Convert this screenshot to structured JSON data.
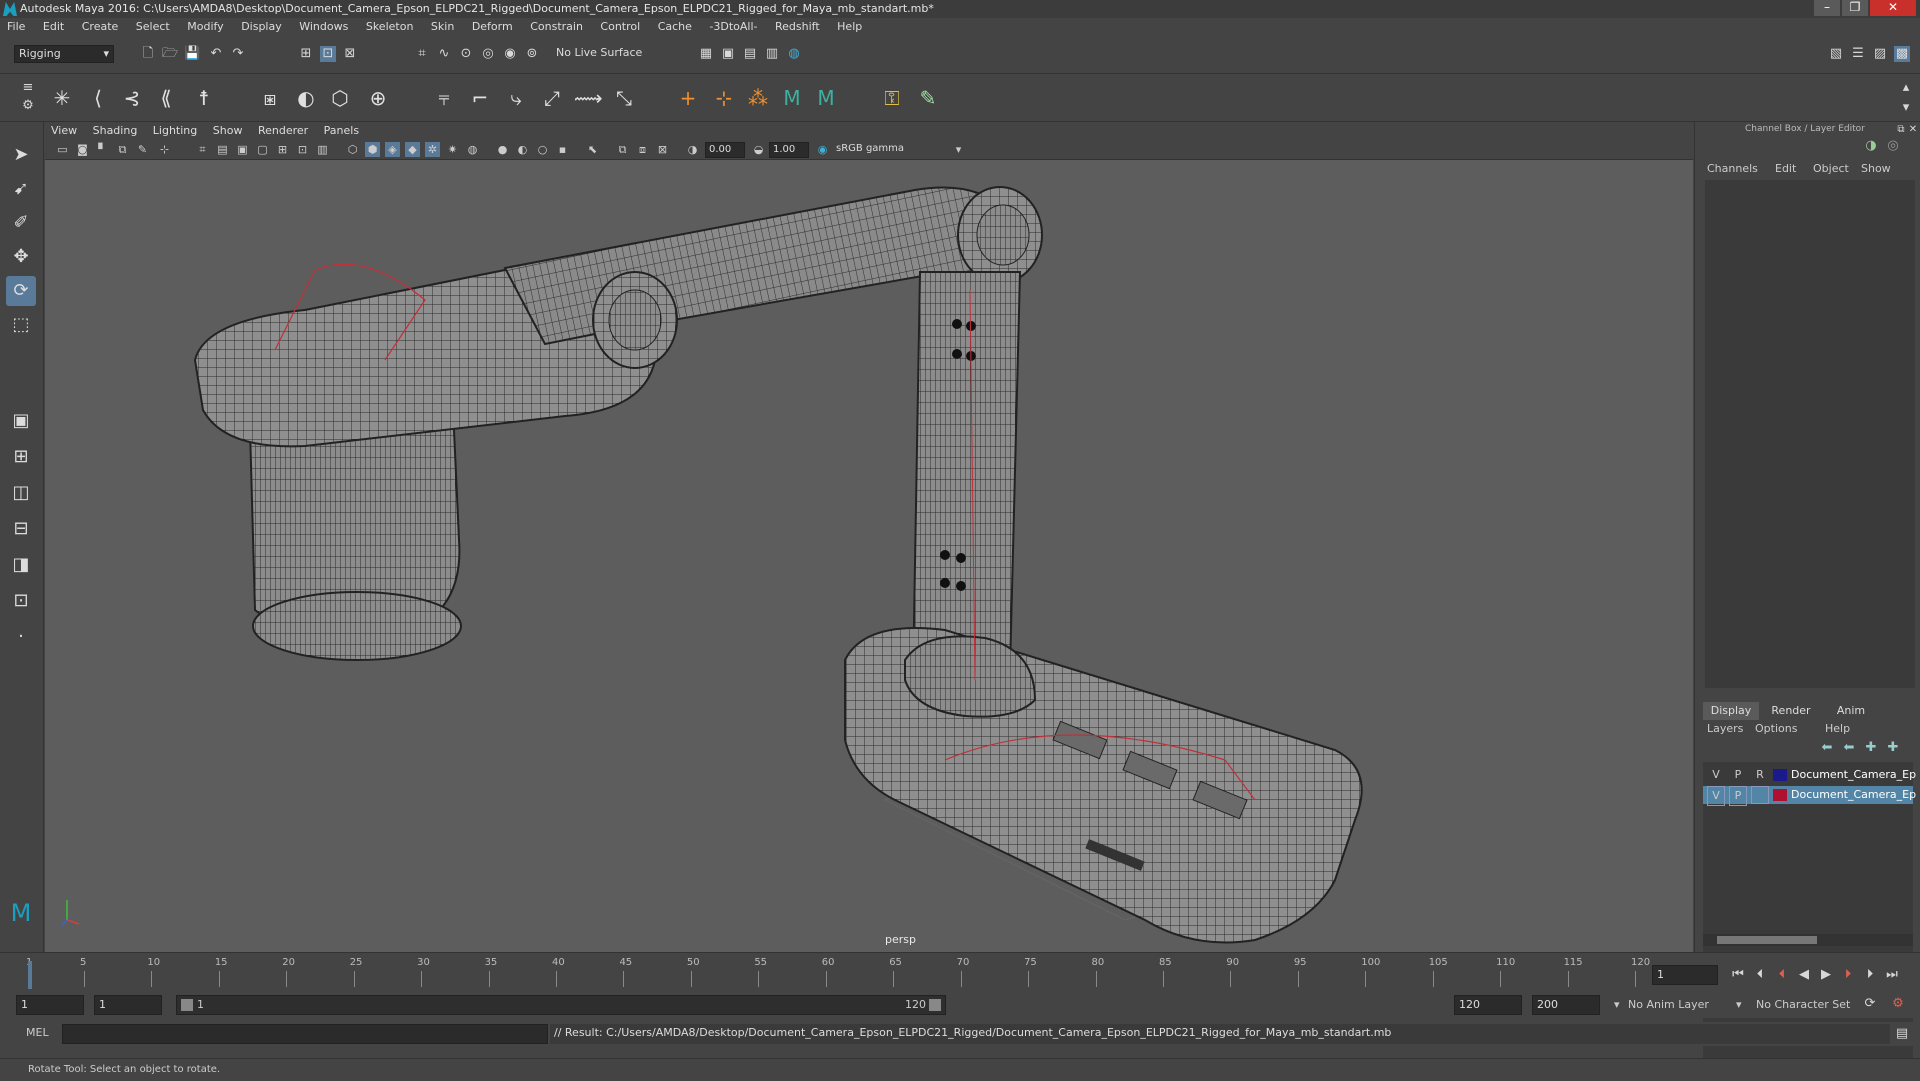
{
  "window": {
    "title": "Autodesk Maya 2016: C:\\Users\\AMDA8\\Desktop\\Document_Camera_Epson_ELPDC21_Rigged\\Document_Camera_Epson_ELPDC21_Rigged_for_Maya_mb_standart.mb*",
    "controls": [
      "–",
      "❐",
      "✕"
    ]
  },
  "menubar": [
    "File",
    "Edit",
    "Create",
    "Select",
    "Modify",
    "Display",
    "Windows",
    "Skeleton",
    "Skin",
    "Deform",
    "Constrain",
    "Control",
    "Cache",
    "-3DtoAll-",
    "Redshift",
    "Help"
  ],
  "statusline": {
    "menuset": "Rigging",
    "live_surface": "No Live Surface"
  },
  "viewport": {
    "menu": [
      "View",
      "Shading",
      "Lighting",
      "Show",
      "Renderer",
      "Panels"
    ],
    "exposure": "0.00",
    "gamma": "1.00",
    "color_space": "sRGB gamma",
    "camera_label": "persp"
  },
  "channel_box": {
    "title": "Channel Box / Layer Editor",
    "menu": [
      "Channels",
      "Edit",
      "Object",
      "Show"
    ]
  },
  "layer_editor": {
    "tabs": [
      "Display",
      "Render",
      "Anim"
    ],
    "active_tab": "Display",
    "menu": [
      "Layers",
      "Options",
      "Help"
    ],
    "layers": [
      {
        "v": "V",
        "p": "P",
        "r": "R",
        "color": "#1a1a8c",
        "name": "Document_Camera_Ep",
        "selected": false
      },
      {
        "v": "V",
        "p": "P",
        "r": "",
        "color": "#b01030",
        "name": "Document_Camera_Ep",
        "selected": true
      }
    ]
  },
  "timeslider": {
    "ticks": [
      "1",
      "5",
      "10",
      "15",
      "20",
      "25",
      "30",
      "35",
      "40",
      "45",
      "50",
      "55",
      "60",
      "65",
      "70",
      "75",
      "80",
      "85",
      "90",
      "95",
      "100",
      "105",
      "110",
      "115",
      "120"
    ],
    "current_frame": "1"
  },
  "range": {
    "start": "1",
    "playback_start": "1",
    "range_start_label": "1",
    "range_end_label": "120",
    "playback_end": "120",
    "end": "200",
    "anim_layer": "No Anim Layer",
    "character_set": "No Character Set"
  },
  "command_line": {
    "label": "MEL",
    "result": "// Result: C:/Users/AMDA8/Desktop/Document_Camera_Epson_ELPDC21_Rigged/Document_Camera_Epson_ELPDC21_Rigged_for_Maya_mb_standart.mb"
  },
  "help_line": "Rotate Tool: Select an object to rotate."
}
